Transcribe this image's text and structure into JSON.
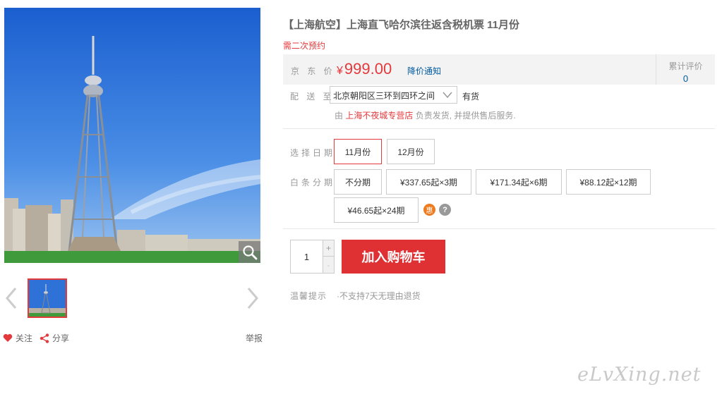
{
  "product": {
    "title": "【上海航空】上海直飞哈尔滨往返含税机票 11月份",
    "notice": "需二次预约"
  },
  "gallery": {
    "thumb_count": 1,
    "icons": [
      "zoom-icon",
      "chevron-left-icon",
      "chevron-right-icon"
    ]
  },
  "actions": {
    "follow": "关注",
    "share": "分享",
    "report": "举报"
  },
  "price": {
    "label": "京 东 价",
    "currency": "¥",
    "amount": "999.00",
    "notify": "降价通知",
    "review_label": "累计评价",
    "review_count": "0",
    "color": "#e4393c"
  },
  "delivery": {
    "label": "配 送 至",
    "location": "北京朝阳区三环到四环之间",
    "stock": "有货",
    "ship_prefix": "由",
    "store": "上海不夜城专营店",
    "ship_suffix": "负责发货, 并提供售后服务."
  },
  "date": {
    "label": "选择日期",
    "options": [
      "11月份",
      "12月份"
    ],
    "selected": "11月份"
  },
  "installment": {
    "label": "白条分期",
    "options": [
      "不分期",
      "¥337.65起×3期",
      "¥171.34起×6期",
      "¥88.12起×12期",
      "¥46.65起×24期"
    ],
    "badge": "惠",
    "help": "?"
  },
  "purchase": {
    "quantity": "1",
    "plus": "+",
    "minus": "-",
    "cart_button": "加入购物车",
    "button_color": "#df3033"
  },
  "tips": {
    "label": "温馨提示",
    "text": "·不支持7天无理由退货"
  },
  "watermark": "eLvXing.net"
}
